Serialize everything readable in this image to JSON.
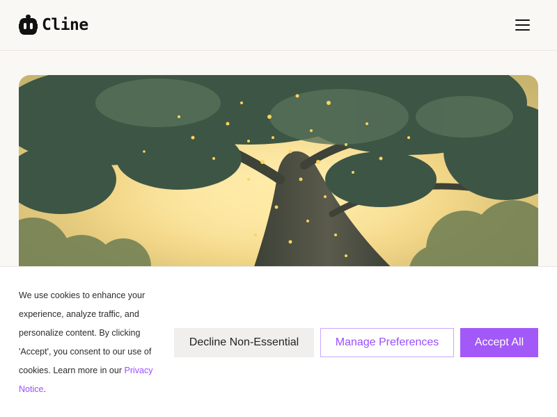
{
  "header": {
    "logo_text": "Cline",
    "logo_icon": "cline-robot-logo-icon",
    "menu_icon": "hamburger-menu-icon"
  },
  "hero": {
    "image": "glowing-tree-illustration",
    "colors": {
      "sky": "#f4d98a",
      "foliage": "#3f5a46",
      "trunk": "#4a4a3e",
      "glow": "#ffd35c"
    }
  },
  "cookie_banner": {
    "text": "We use cookies to enhance your experience, analyze traffic, and personalize content. By clicking 'Accept', you consent to our use of cookies. Learn more in our",
    "privacy_link": "Privacy Notice",
    "text_end": ".",
    "decline_label": "Decline Non-Essential",
    "manage_label": "Manage Preferences",
    "accept_label": "Accept All",
    "accent_color": "#a259f7"
  }
}
